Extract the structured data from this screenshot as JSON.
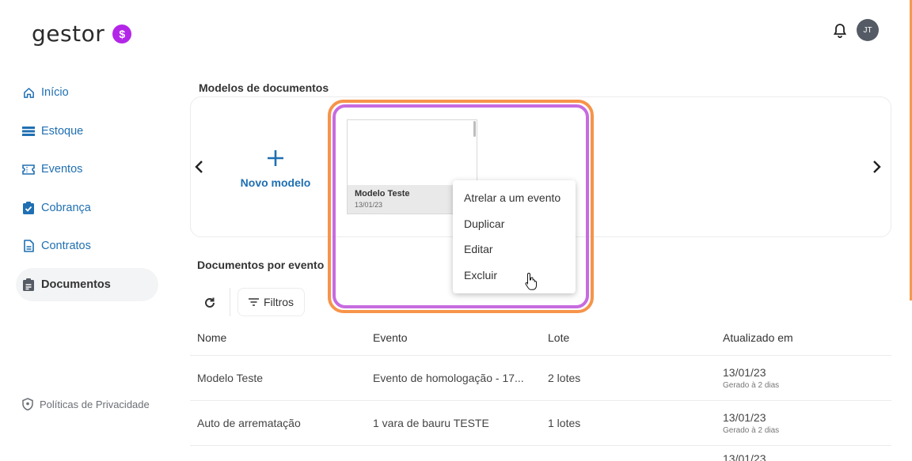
{
  "header": {
    "logo_text": "gestor",
    "logo_badge": "$",
    "avatar_initials": "JT"
  },
  "sidebar": {
    "items": [
      {
        "label": "Início",
        "icon": "home-icon"
      },
      {
        "label": "Estoque",
        "icon": "list-icon"
      },
      {
        "label": "Eventos",
        "icon": "ticket-icon"
      },
      {
        "label": "Cobrança",
        "icon": "clipboard-check-icon"
      },
      {
        "label": "Contratos",
        "icon": "file-icon"
      },
      {
        "label": "Documentos",
        "icon": "clipboard-icon",
        "active": true
      }
    ],
    "privacy": "Políticas de Privacidade"
  },
  "models": {
    "title": "Modelos de documentos",
    "new_label": "Novo modelo",
    "card": {
      "name": "Modelo Teste",
      "date": "13/01/23"
    },
    "menu": [
      "Atrelar a um evento",
      "Duplicar",
      "Editar",
      "Excluir"
    ]
  },
  "documents": {
    "title": "Documentos por evento",
    "filter_label": "Filtros",
    "columns": [
      "Nome",
      "Evento",
      "Lote",
      "Atualizado em"
    ],
    "rows": [
      {
        "nome": "Modelo Teste",
        "evento": "Evento de homologação - 17...",
        "lote": "2 lotes",
        "data": "13/01/23",
        "sub": "Gerado à 2 dias"
      },
      {
        "nome": "Auto de arrematação",
        "evento": "1 vara de bauru TESTE",
        "lote": "1 lotes",
        "data": "13/01/23",
        "sub": "Gerado à 2 dias"
      }
    ],
    "partial_date": "13/01/23"
  },
  "colors": {
    "accent": "#1f6fb2",
    "brand": "#b326e8",
    "highlight_outer": "#f6944a",
    "highlight_inner": "#c76be0"
  }
}
